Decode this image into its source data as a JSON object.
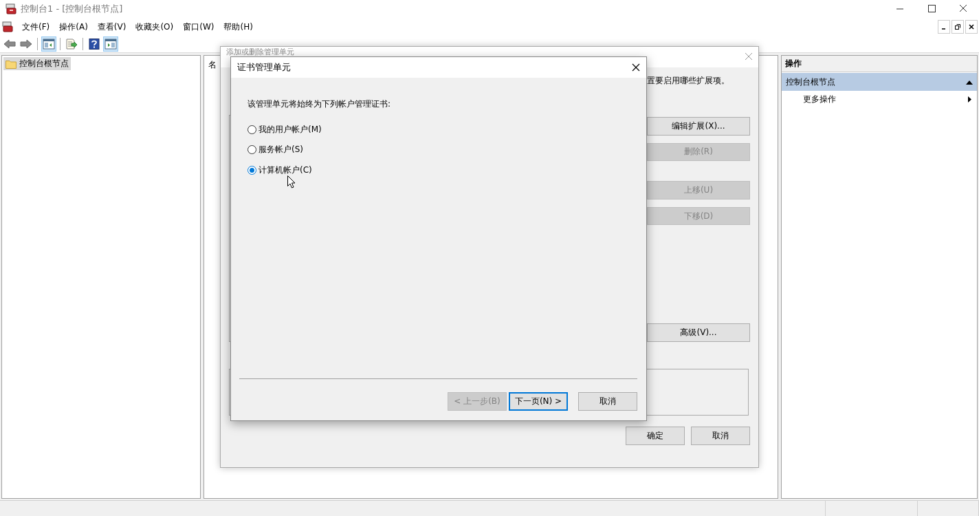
{
  "window": {
    "title": "控制台1 - [控制台根节点]"
  },
  "menu": [
    {
      "label": "文件(F)"
    },
    {
      "label": "操作(A)"
    },
    {
      "label": "查看(V)"
    },
    {
      "label": "收藏夹(O)"
    },
    {
      "label": "窗口(W)"
    },
    {
      "label": "帮助(H)"
    }
  ],
  "toolbar": [
    {
      "kind": "back",
      "pressed": false
    },
    {
      "kind": "forward",
      "pressed": false
    },
    {
      "kind": "separator"
    },
    {
      "kind": "tree",
      "pressed": true
    },
    {
      "kind": "separator"
    },
    {
      "kind": "export",
      "pressed": false
    },
    {
      "kind": "separator"
    },
    {
      "kind": "help",
      "pressed": false
    },
    {
      "kind": "actionpane",
      "pressed": true
    }
  ],
  "tree": {
    "items": [
      {
        "label": "控制台根节点",
        "selected": true
      }
    ]
  },
  "list_pane": {
    "column_1": "名"
  },
  "actions_pane": {
    "title": "操作",
    "sections": [
      {
        "label": "控制台根节点",
        "expanded": true,
        "items": [
          {
            "label": "更多操作",
            "submenu": true
          }
        ]
      }
    ]
  },
  "back_dialog": {
    "title": "添加或删除管理单元",
    "instruction": "置要启用哪些扩展项。",
    "buttons": [
      {
        "label": "编辑扩展(X)...",
        "disabled": false
      },
      {
        "label": "删除(R)",
        "disabled": true
      },
      {
        "label": "上移(U)",
        "disabled": true
      },
      {
        "label": "下移(D)",
        "disabled": true
      },
      {
        "label": "高级(V)...",
        "disabled": false
      }
    ],
    "footer_buttons": [
      {
        "label": "确定"
      },
      {
        "label": "取消"
      }
    ]
  },
  "cert_dialog": {
    "title": "证书管理单元",
    "prompt": "该管理单元将始终为下列帐户管理证书:",
    "options": [
      {
        "label": "我的用户帐户(M)",
        "selected": false
      },
      {
        "label": "服务帐户(S)",
        "selected": false
      },
      {
        "label": "计算机帐户(C)",
        "selected": true
      }
    ],
    "buttons": [
      {
        "label": "< 上一步(B)",
        "disabled": true,
        "focused": false
      },
      {
        "label": "下一页(N) >",
        "disabled": false,
        "focused": true
      },
      {
        "label": "取消",
        "disabled": false,
        "focused": false
      }
    ]
  }
}
